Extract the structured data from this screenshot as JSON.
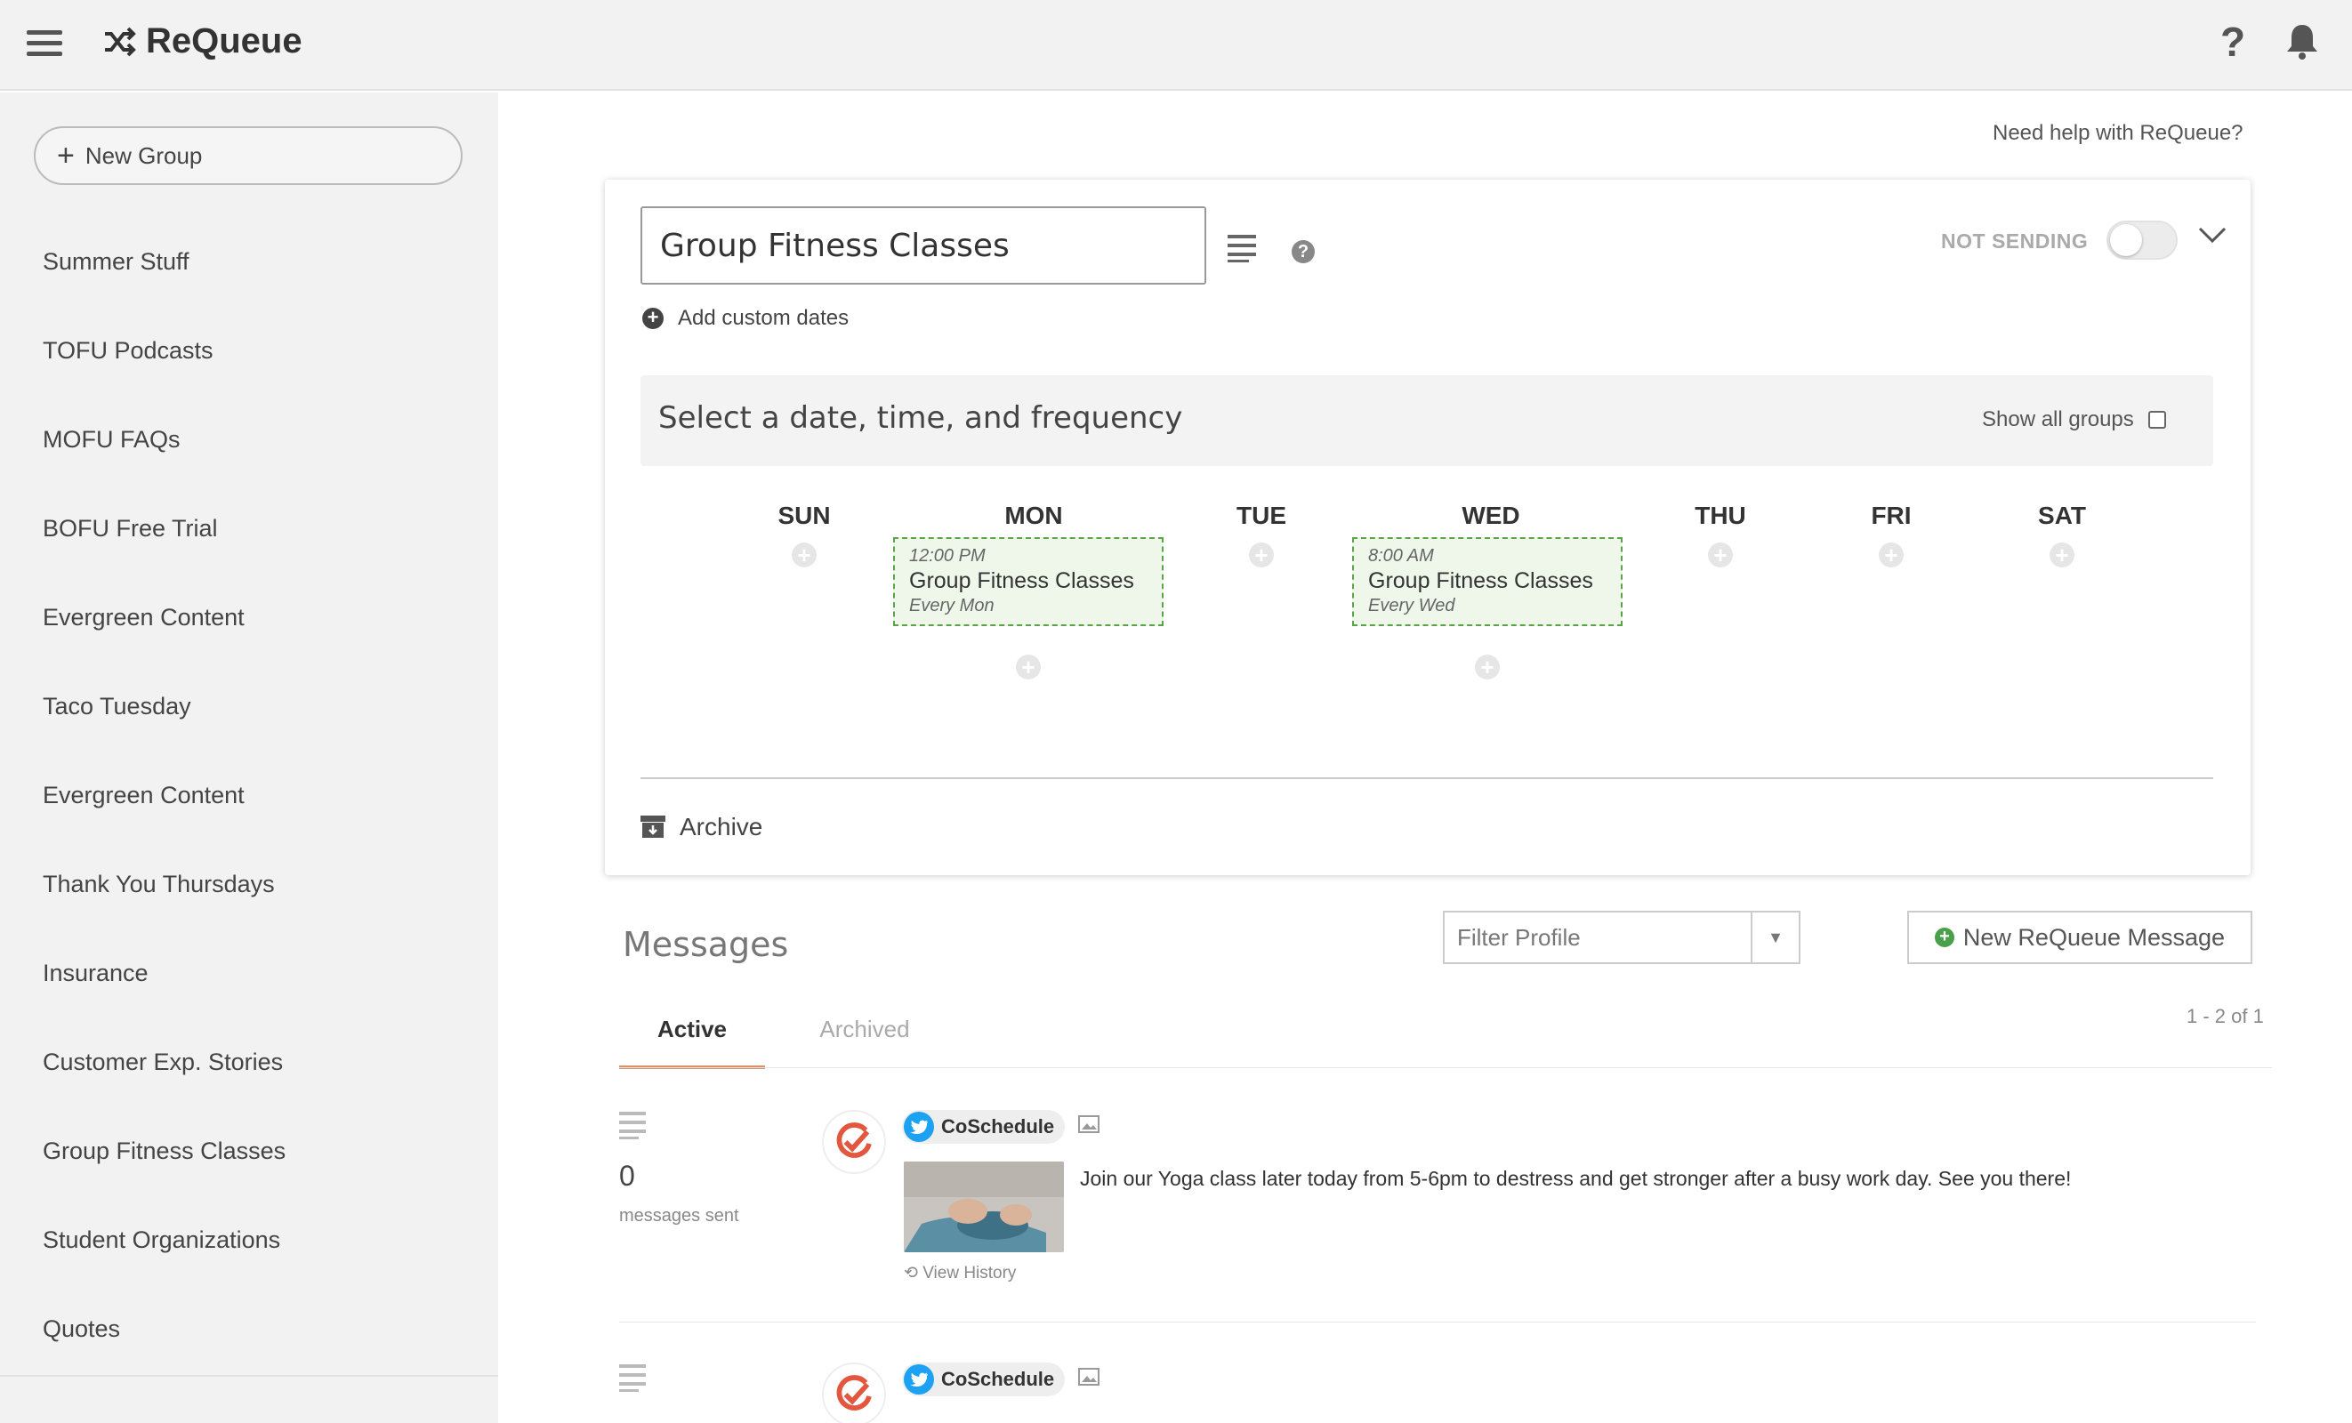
{
  "app": {
    "name": "ReQueue"
  },
  "header": {
    "help_glyph": "?"
  },
  "sidebar": {
    "new_group_label": "New Group",
    "items": [
      "Summer Stuff",
      "TOFU Podcasts",
      "MOFU FAQs",
      "BOFU Free Trial",
      "Evergreen Content",
      "Taco Tuesday",
      "Evergreen Content",
      "Thank You Thursdays",
      "Insurance",
      "Customer Exp. Stories",
      "Group Fitness Classes",
      "Student Organizations",
      "Quotes"
    ]
  },
  "main": {
    "need_help": "Need help with ReQueue?",
    "group": {
      "name_value": "Group Fitness Classes",
      "status": "NOT SENDING",
      "add_custom_dates": "Add custom dates",
      "frequency_title": "Select a date, time, and frequency",
      "show_all_groups": "Show all groups",
      "days": [
        "SUN",
        "MON",
        "TUE",
        "WED",
        "THU",
        "FRI",
        "SAT"
      ],
      "slots": [
        {
          "day": "MON",
          "time": "12:00 PM",
          "name": "Group Fitness Classes",
          "freq": "Every Mon"
        },
        {
          "day": "WED",
          "time": "8:00 AM",
          "name": "Group Fitness Classes",
          "freq": "Every Wed"
        }
      ],
      "archive_label": "Archive"
    },
    "messages": {
      "title": "Messages",
      "filter_placeholder": "Filter Profile",
      "new_message_label": "New ReQueue Message",
      "tabs": {
        "active": "Active",
        "archived": "Archived"
      },
      "pagination": "1 - 2 of 1",
      "rows": [
        {
          "sent_count": "0",
          "sent_label": "messages sent",
          "profile": "CoSchedule",
          "text": "Join our Yoga class later today from 5-6pm to destress and get stronger after a busy work day. See you there!",
          "view_history": "View History"
        },
        {
          "profile": "CoSchedule"
        }
      ]
    }
  },
  "colors": {
    "accent_tab": "#d9906c",
    "slot_border": "#5aa448",
    "slot_bg": "#eef7ea",
    "twitter": "#1da1f2",
    "coschedule_red": "#e2573e"
  }
}
